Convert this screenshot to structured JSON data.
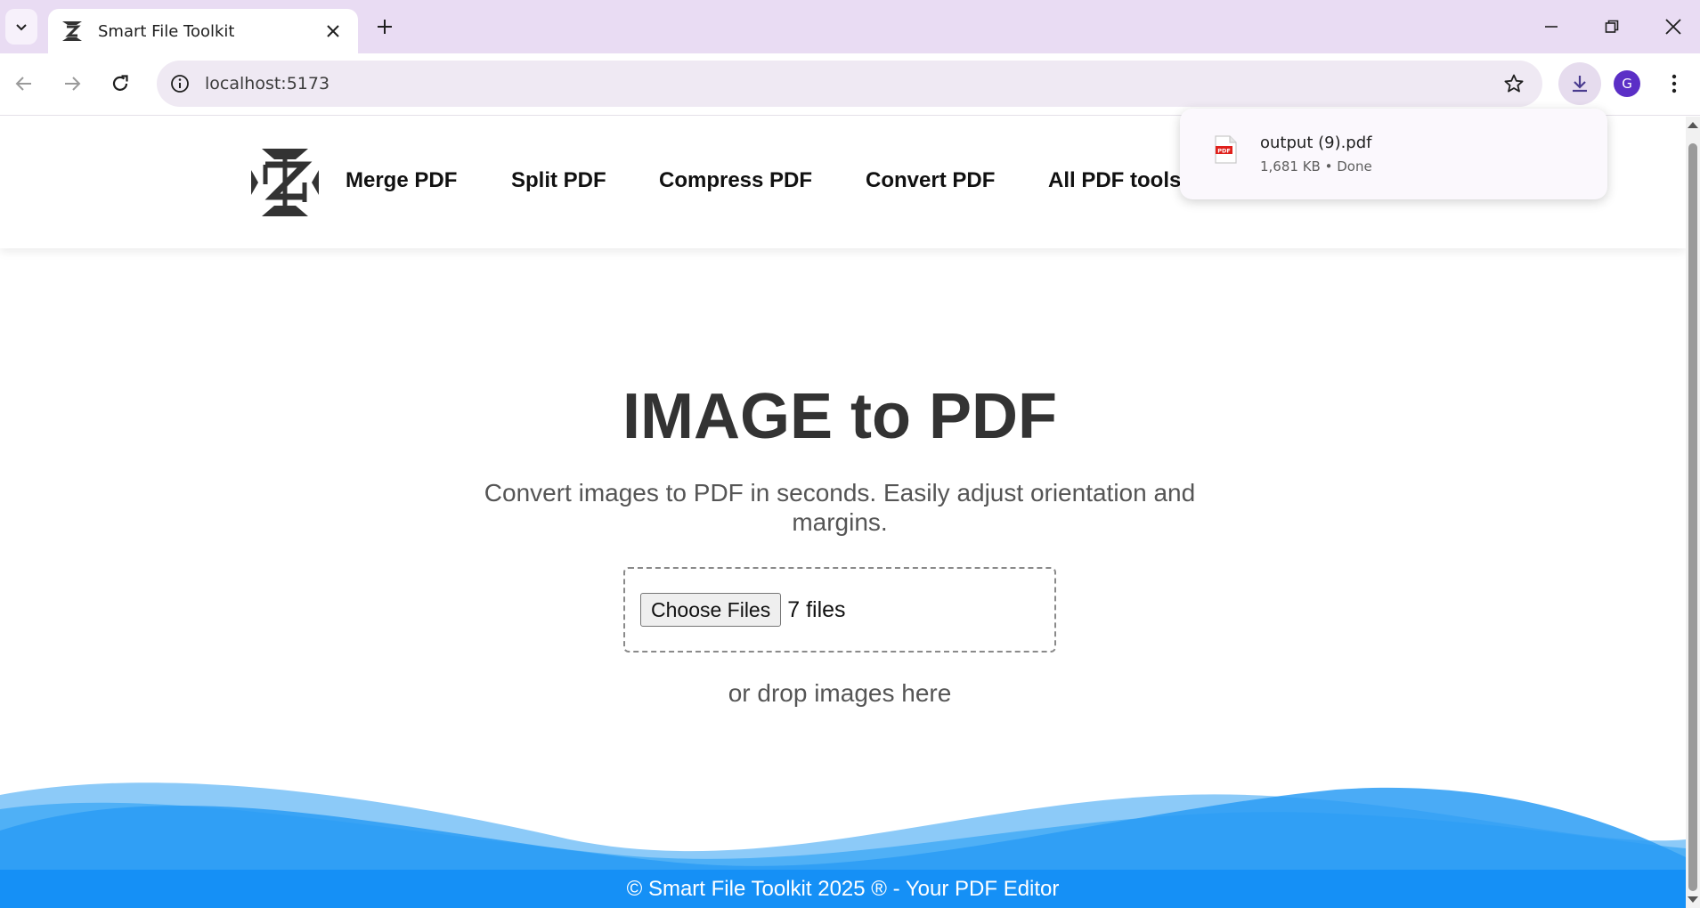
{
  "browser": {
    "tab": {
      "title": "Smart File Toolkit",
      "favicon": "toolkit-logo-icon"
    },
    "url": "localhost:5173",
    "profile_initial": "G",
    "download": {
      "filename": "output (9).pdf",
      "status": "1,681 KB • Done",
      "file_icon_label": "PDF"
    }
  },
  "site": {
    "nav": {
      "merge": "Merge PDF",
      "split": "Split PDF",
      "compress": "Compress PDF",
      "convert": "Convert PDF",
      "all": "All PDF tools"
    },
    "title": "IMAGE to PDF",
    "subtitle": "Convert images to PDF in seconds. Easily adjust orientation and margins.",
    "choose_files_label": "Choose Files",
    "file_count": "7 files",
    "drop_text": "or drop images here",
    "footer": "© Smart File Toolkit 2025 ® - Your PDF Editor"
  },
  "colors": {
    "accent": "#1a82f0",
    "footer": "#1590f6",
    "tabbar": "#e9dcf3",
    "avatar": "#5b2fc6"
  }
}
